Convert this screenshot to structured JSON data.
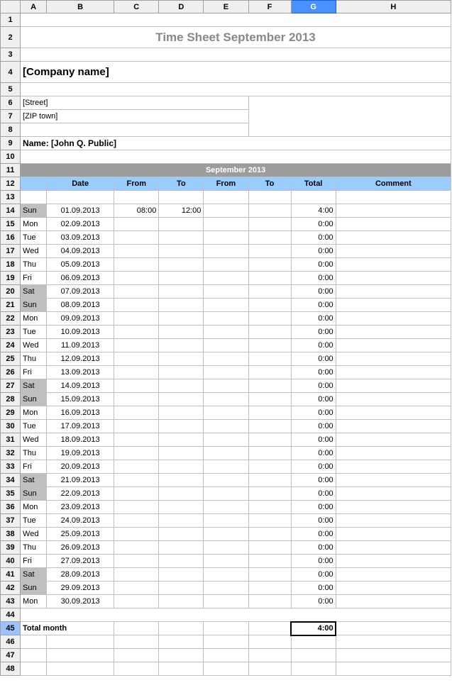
{
  "columns": [
    "A",
    "B",
    "C",
    "D",
    "E",
    "F",
    "G",
    "H"
  ],
  "selected_col": "G",
  "selected_row": 45,
  "title": "Time Sheet September 2013",
  "company": "[Company name]",
  "street": "[Street]",
  "zip": "[ZIP town]",
  "name": "Name: [John Q. Public]",
  "month_title": "September 2013",
  "headers": {
    "b": "Date",
    "c": "From",
    "d": "To",
    "e": "From",
    "f": "To",
    "g": "Total",
    "h": "Comment"
  },
  "entries": [
    {
      "row": 14,
      "day": "Sun",
      "weekend": true,
      "date": "01.09.2013",
      "from1": "08:00",
      "to1": "12:00",
      "total": "4:00"
    },
    {
      "row": 15,
      "day": "Mon",
      "weekend": false,
      "date": "02.09.2013",
      "total": "0:00"
    },
    {
      "row": 16,
      "day": "Tue",
      "weekend": false,
      "date": "03.09.2013",
      "total": "0:00"
    },
    {
      "row": 17,
      "day": "Wed",
      "weekend": false,
      "date": "04.09.2013",
      "total": "0:00"
    },
    {
      "row": 18,
      "day": "Thu",
      "weekend": false,
      "date": "05.09.2013",
      "total": "0:00"
    },
    {
      "row": 19,
      "day": "Fri",
      "weekend": false,
      "date": "06.09.2013",
      "total": "0:00"
    },
    {
      "row": 20,
      "day": "Sat",
      "weekend": true,
      "date": "07.09.2013",
      "total": "0:00"
    },
    {
      "row": 21,
      "day": "Sun",
      "weekend": true,
      "date": "08.09.2013",
      "total": "0:00"
    },
    {
      "row": 22,
      "day": "Mon",
      "weekend": false,
      "date": "09.09.2013",
      "total": "0:00"
    },
    {
      "row": 23,
      "day": "Tue",
      "weekend": false,
      "date": "10.09.2013",
      "total": "0:00"
    },
    {
      "row": 24,
      "day": "Wed",
      "weekend": false,
      "date": "11.09.2013",
      "total": "0:00"
    },
    {
      "row": 25,
      "day": "Thu",
      "weekend": false,
      "date": "12.09.2013",
      "total": "0:00"
    },
    {
      "row": 26,
      "day": "Fri",
      "weekend": false,
      "date": "13.09.2013",
      "total": "0:00"
    },
    {
      "row": 27,
      "day": "Sat",
      "weekend": true,
      "date": "14.09.2013",
      "total": "0:00"
    },
    {
      "row": 28,
      "day": "Sun",
      "weekend": true,
      "date": "15.09.2013",
      "total": "0:00"
    },
    {
      "row": 29,
      "day": "Mon",
      "weekend": false,
      "date": "16.09.2013",
      "total": "0:00"
    },
    {
      "row": 30,
      "day": "Tue",
      "weekend": false,
      "date": "17.09.2013",
      "total": "0:00"
    },
    {
      "row": 31,
      "day": "Wed",
      "weekend": false,
      "date": "18.09.2013",
      "total": "0:00"
    },
    {
      "row": 32,
      "day": "Thu",
      "weekend": false,
      "date": "19.09.2013",
      "total": "0:00"
    },
    {
      "row": 33,
      "day": "Fri",
      "weekend": false,
      "date": "20.09.2013",
      "total": "0:00"
    },
    {
      "row": 34,
      "day": "Sat",
      "weekend": true,
      "date": "21.09.2013",
      "total": "0:00"
    },
    {
      "row": 35,
      "day": "Sun",
      "weekend": true,
      "date": "22.09.2013",
      "total": "0:00"
    },
    {
      "row": 36,
      "day": "Mon",
      "weekend": false,
      "date": "23.09.2013",
      "total": "0:00"
    },
    {
      "row": 37,
      "day": "Tue",
      "weekend": false,
      "date": "24.09.2013",
      "total": "0:00"
    },
    {
      "row": 38,
      "day": "Wed",
      "weekend": false,
      "date": "25.09.2013",
      "total": "0:00"
    },
    {
      "row": 39,
      "day": "Thu",
      "weekend": false,
      "date": "26.09.2013",
      "total": "0:00"
    },
    {
      "row": 40,
      "day": "Fri",
      "weekend": false,
      "date": "27.09.2013",
      "total": "0:00"
    },
    {
      "row": 41,
      "day": "Sat",
      "weekend": true,
      "date": "28.09.2013",
      "total": "0:00"
    },
    {
      "row": 42,
      "day": "Sun",
      "weekend": true,
      "date": "29.09.2013",
      "total": "0:00"
    },
    {
      "row": 43,
      "day": "Mon",
      "weekend": false,
      "date": "30.09.2013",
      "total": "0:00"
    }
  ],
  "total_label": "Total month",
  "total_value": "4:00"
}
